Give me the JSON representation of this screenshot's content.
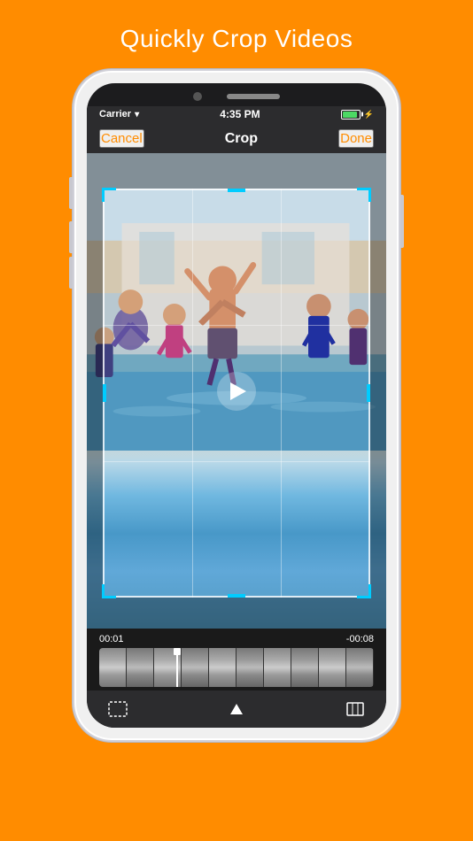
{
  "page": {
    "title": "Quickly Crop Videos",
    "background_color": "#FF8C00"
  },
  "status_bar": {
    "carrier": "Carrier",
    "time": "4:35 PM",
    "battery_label": "Battery"
  },
  "nav_bar": {
    "cancel_label": "Cancel",
    "title": "Crop",
    "done_label": "Done"
  },
  "timeline": {
    "start_time": "00:01",
    "end_time": "-00:08",
    "thumb_count": 10
  },
  "video": {
    "play_button_label": "Play"
  }
}
